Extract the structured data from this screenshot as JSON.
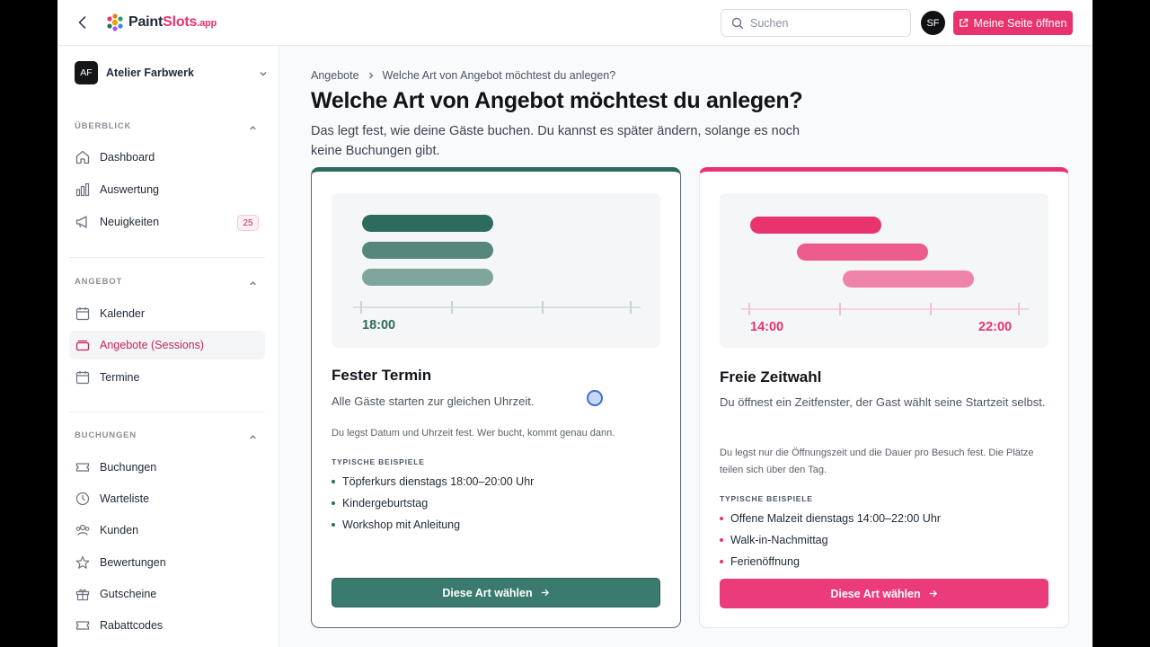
{
  "header": {
    "logo_main": "Paint",
    "logo_accent": "Slots",
    "logo_tld": ".app",
    "search_placeholder": "Suchen",
    "user_initials": "SF",
    "open_page_label": "Meine Seite öffnen"
  },
  "sidebar": {
    "workspace_initials": "AF",
    "workspace_name": "Atelier Farbwerk",
    "sections": [
      {
        "title": "ÜBERBLICK",
        "items": [
          {
            "label": "Dashboard",
            "icon": "home-icon"
          },
          {
            "label": "Auswertung",
            "icon": "bar-chart-icon"
          },
          {
            "label": "Neuigkeiten",
            "icon": "megaphone-icon",
            "badge": "25"
          }
        ]
      },
      {
        "title": "ANGEBOT",
        "items": [
          {
            "label": "Kalender",
            "icon": "calendar-icon"
          },
          {
            "label": "Angebote (Sessions)",
            "icon": "stack-icon",
            "active": true
          },
          {
            "label": "Termine",
            "icon": "calendar-icon"
          }
        ]
      },
      {
        "title": "BUCHUNGEN",
        "items": [
          {
            "label": "Buchungen",
            "icon": "ticket-icon"
          },
          {
            "label": "Warteliste",
            "icon": "clock-icon"
          },
          {
            "label": "Kunden",
            "icon": "users-icon"
          },
          {
            "label": "Bewertungen",
            "icon": "star-icon"
          },
          {
            "label": "Gutscheine",
            "icon": "gift-icon"
          },
          {
            "label": "Rabattcodes",
            "icon": "ticket-icon"
          }
        ]
      }
    ]
  },
  "main": {
    "breadcrumb": [
      "Angebote",
      "Welche Art von Angebot möchtest du anlegen?"
    ],
    "title": "Welche Art von Angebot möchtest du anlegen?",
    "subtitle": "Das legt fest, wie deine Gäste buchen. Du kannst es später ändern, solange es noch keine Buchungen gibt.",
    "cards": [
      {
        "title": "Fester Termin",
        "lead": "Alle Gäste starten zur gleichen Uhrzeit.",
        "desc": "Du legst Datum und Uhrzeit fest. Wer bucht, kommt genau dann.",
        "examples_title": "TYPISCHE BEISPIELE",
        "examples": [
          "Töpferkurs dienstags 18:00–20:00 Uhr",
          "Kindergeburtstag",
          "Workshop mit Anleitung"
        ],
        "time_start": "18:00",
        "button": "Diese Art wählen",
        "color": "#2e6b5f"
      },
      {
        "title": "Freie Zeitwahl",
        "lead": "Du öffnest ein Zeitfenster, der Gast wählt seine Startzeit selbst.",
        "desc": "Du legst nur die Öffnungszeit und die Dauer pro Besuch fest. Die Plätze teilen sich über den Tag.",
        "examples_title": "TYPISCHE BEISPIELE",
        "examples": [
          "Offene Malzeit dienstags 14:00–22:00 Uhr",
          "Walk-in-Nachmittag",
          "Ferienöffnung"
        ],
        "time_start": "14:00",
        "time_end": "22:00",
        "button": "Diese Art wählen",
        "color": "#e8336f"
      }
    ]
  }
}
